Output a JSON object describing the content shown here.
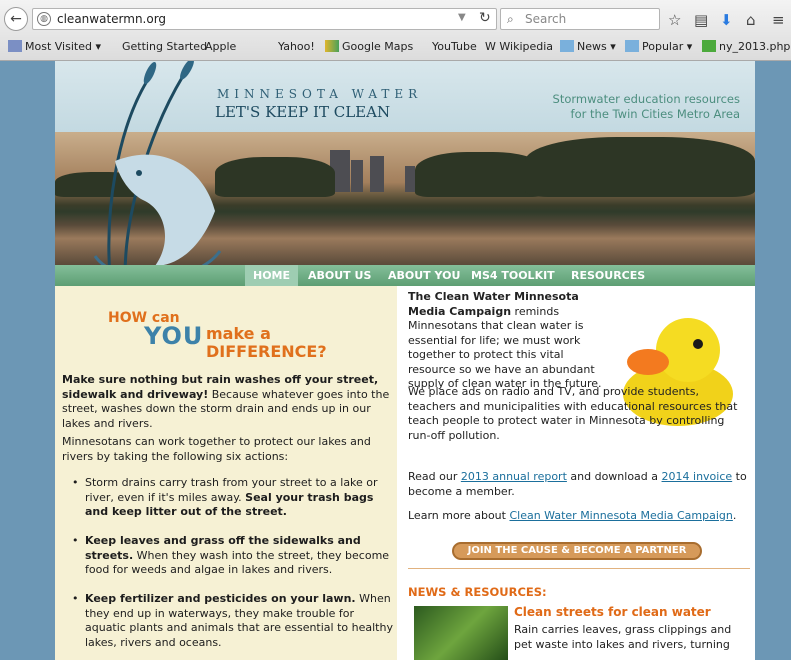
{
  "browser": {
    "url": "cleanwatermn.org",
    "search_placeholder": "Search",
    "bookmarks": [
      "Most Visited",
      "Getting Started",
      "Apple",
      "Yahoo!",
      "Google Maps",
      "YouTube",
      "Wikipedia",
      "News",
      "Popular",
      "ny_2013.php"
    ]
  },
  "header": {
    "brand_top": "MINNESOTA WATER",
    "brand_bottom": "LET'S KEEP IT CLEAN",
    "tagline_1": "Stormwater education resources",
    "tagline_2": "for the Twin Cities Metro Area"
  },
  "nav": [
    "HOME",
    "ABOUT US",
    "ABOUT YOU",
    "MS4 TOOLKIT",
    "RESOURCES"
  ],
  "left": {
    "how": "HOW can",
    "you": "YOU",
    "make": "make a",
    "difference": "DIFFERENCE?",
    "intro_bold": "Make sure nothing but rain washes off your street, sidewalk and driveway!",
    "intro_rest": " Because whatever goes into the street, washes down the storm drain and ends up in our lakes and rivers.",
    "para2": "Minnesotans can work together to protect our lakes and rivers by taking the following six actions:",
    "bullets": [
      {
        "text": "Storm drains carry trash from your street to a lake or river, even if it's miles away. ",
        "bold": "Seal your trash bags and keep litter out of the street."
      },
      {
        "bold": "Keep leaves and grass off the sidewalks and streets.",
        "text": " When they wash into the street, they become food for weeds and algae in lakes and rivers."
      },
      {
        "bold": "Keep fertilizer and pesticides on your lawn.",
        "text": " When they end up in waterways, they make trouble for aquatic plants and animals that are essential to healthy lakes, rivers and oceans."
      }
    ]
  },
  "right": {
    "campaign_bold": "The Clean Water Minnesota Media Campaign",
    "campaign_rest": " reminds Minnesotans that clean water is essential for life; we must work together to protect this vital resource so we have an abundant supply of clean water in the future.",
    "ads_text": "We place ads on radio and TV, and provide students, teachers and municipalities with educational resources that teach people to protect water in Minnesota by controlling run-off pollution.",
    "read_prefix": "Read our ",
    "annual_link": "2013 annual report",
    "read_mid": " and download a ",
    "invoice_link": "2014 invoice",
    "read_suffix": " to become a member.",
    "learn_prefix": "Learn more about ",
    "learn_link": "Clean Water Minnesota Media Campaign",
    "learn_suffix": ".",
    "join_button": "JOIN THE CAUSE & BECOME A PARTNER",
    "news_heading": "NEWS & RESOURCES:",
    "news_title": "Clean streets for clean water",
    "news_text": "Rain carries leaves, grass clippings and pet waste into lakes and rivers, turning"
  }
}
